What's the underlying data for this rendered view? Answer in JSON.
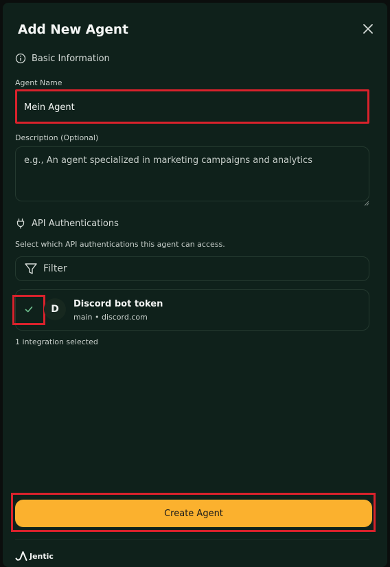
{
  "dialog": {
    "title": "Add New Agent"
  },
  "basic_info": {
    "heading": "Basic Information",
    "name_label": "Agent Name",
    "name_value": "Mein Agent",
    "description_label": "Description (Optional)",
    "description_placeholder": "e.g., An agent specialized in marketing campaigns and analytics"
  },
  "api_auth": {
    "heading": "API Authentications",
    "subtitle": "Select which API authentications this agent can access.",
    "filter_placeholder": "Filter",
    "integrations": [
      {
        "avatar_letter": "D",
        "title": "Discord bot token",
        "subtitle": "main • discord.com",
        "checked": true
      }
    ],
    "selected_count_text": "1 integration selected"
  },
  "footer": {
    "create_label": "Create Agent",
    "brand": "Jentic"
  },
  "colors": {
    "background": "#0f211b",
    "accent": "#fbb12e",
    "check": "#6fc18f"
  }
}
